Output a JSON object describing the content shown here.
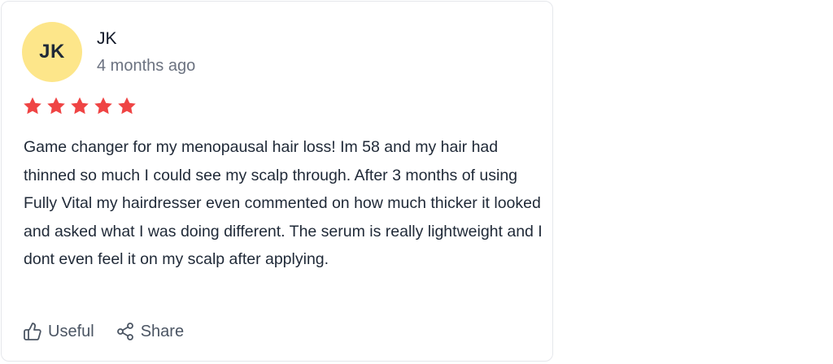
{
  "review": {
    "avatar_initials": "JK",
    "avatar_color": "#fde68a",
    "author": "JK",
    "time": "4 months ago",
    "rating": 5,
    "star_color": "#ef4444",
    "text": "Game changer for my menopausal hair loss! Im 58 and my hair had thinned so much I could see my scalp through. After 3 months of using Fully Vital my hairdresser even commented on how much thicker it looked and asked what I was doing different. The serum is really lightweight and I dont even feel it on my scalp after applying."
  },
  "actions": {
    "useful_label": "Useful",
    "useful_icon": "thumbs-up-icon",
    "share_label": "Share",
    "share_icon": "share-icon"
  }
}
